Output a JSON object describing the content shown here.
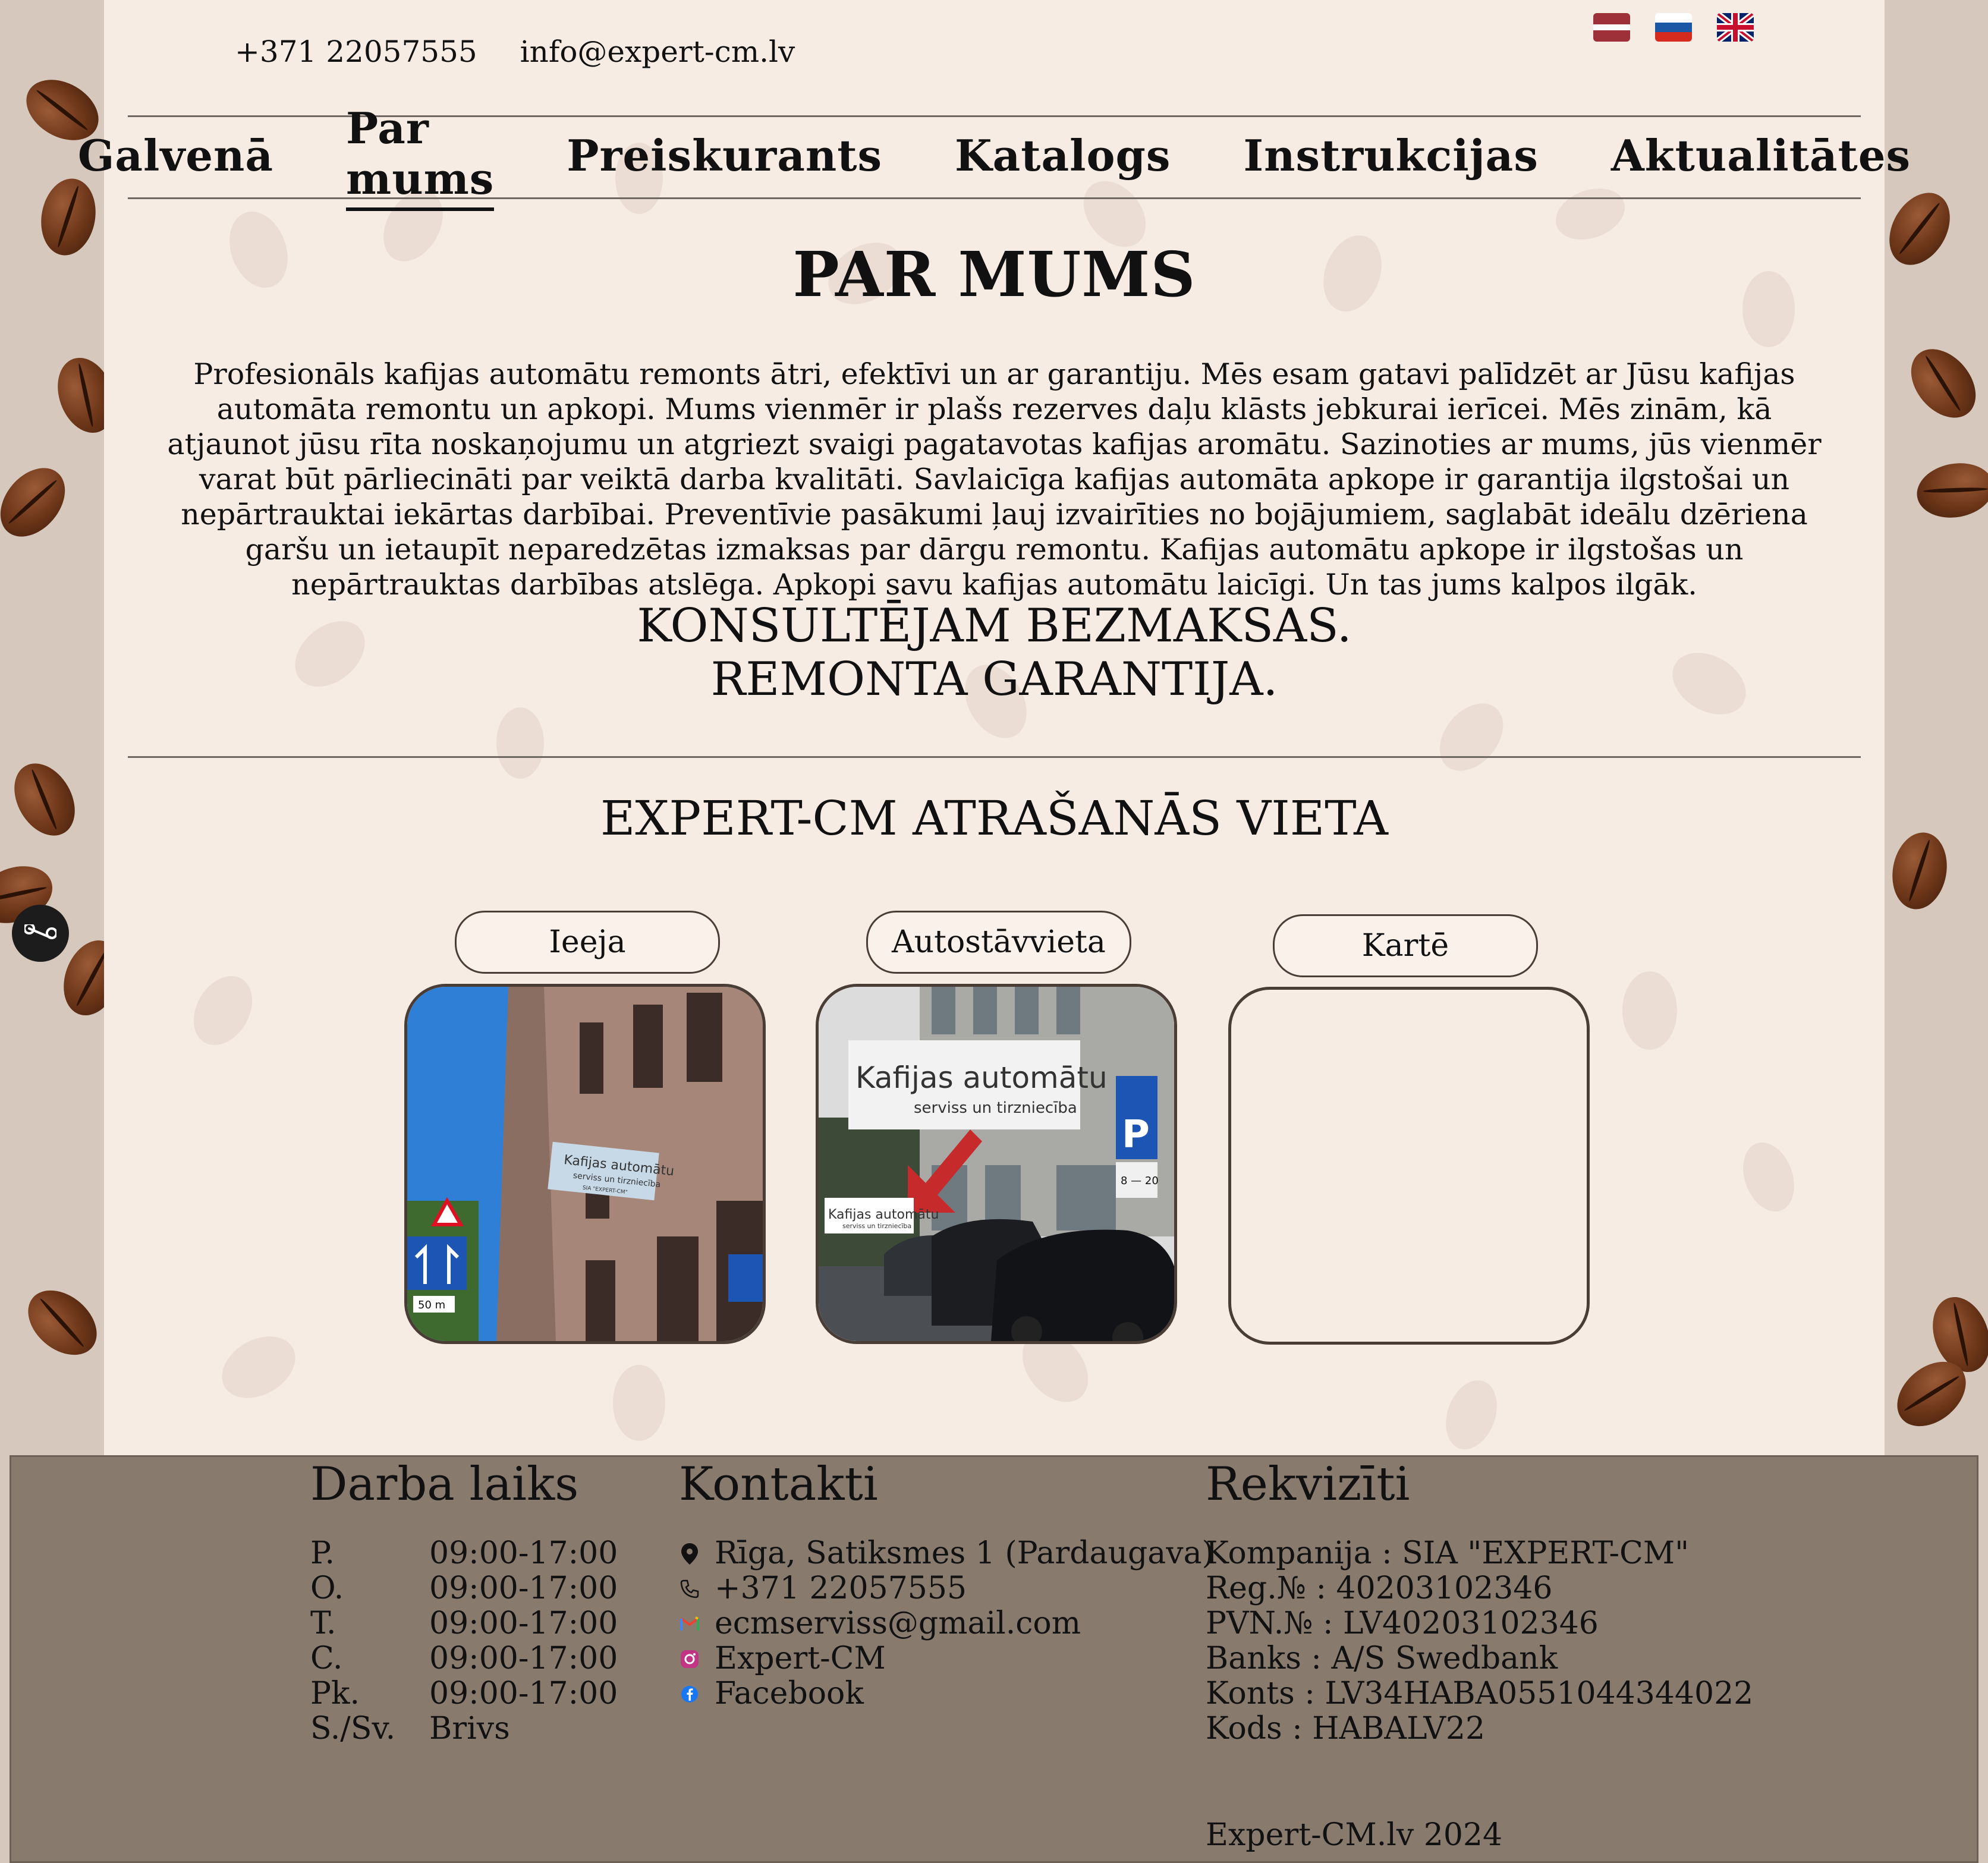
{
  "header": {
    "phone": "+371 22057555",
    "email": "info@expert-cm.lv",
    "flags": [
      "latvia-flag",
      "russia-flag",
      "uk-flag"
    ]
  },
  "nav": {
    "items": [
      {
        "label": "Galvenā"
      },
      {
        "label": "Par mums"
      },
      {
        "label": "Preiskurants"
      },
      {
        "label": "Katalogs"
      },
      {
        "label": "Instrukcijas"
      },
      {
        "label": "Aktualitātes"
      }
    ],
    "active": "Par mums"
  },
  "main": {
    "title": "PAR MUMS",
    "intro": "Profesionāls kafijas automātu remonts ātri, efektīvi un ar garantiju. Mēs esam gatavi palīdzēt ar Jūsu kafijas automāta remontu un apkopi. Mums vienmēr ir plašs rezerves daļu klāsts jebkurai ierīcei. Mēs zinām, kā atjaunot jūsu rīta noskaņojumu un atgriezt svaigi pagatavotas kafijas aromātu. Sazinoties ar mums, jūs vienmēr varat būt pārliecināti par veiktā darba kvalitāti. Savlaicīga kafijas automāta apkope ir garantija ilgstošai un nepārtrauktai iekārtas darbībai. Preventīvie pasākumi ļauj izvairīties no bojājumiem, saglabāt ideālu dzēriena garšu un ietaupīt neparedzētas izmaksas par dārgu remontu. Kafijas automātu apkope ir ilgstošas un nepārtrauktas darbības atslēga. Apkopi savu kafijas automātu laicīgi. Un tas jums kalpos ilgāk.",
    "slogan_line1": "KONSULTĒJAM BEZMAKSAS.",
    "slogan_line2": "REMONTA GARANTIJA.",
    "location_title": "EXPERT-CM ATRAŠANĀS VIETA",
    "cards": [
      {
        "label": "Ieeja"
      },
      {
        "label": "Autostāvvieta"
      },
      {
        "label": "Kartē"
      }
    ],
    "photo_signs": {
      "entrance_sign_line1": "Kafijas automātu",
      "entrance_sign_line2": "serviss un tirzniecība",
      "entrance_sign_line3": "SIA \"EXPERT-CM\"",
      "road_sign_distance": "50 m",
      "parking_banner_line1": "Kafijas automātu",
      "parking_banner_line2": "serviss un tirzniecība",
      "parking_small_sign_line1": "Kafijas automātu",
      "parking_small_sign_line2": "serviss un tirzniecība",
      "parking_letter": "P",
      "parking_hours": "8 — 20"
    }
  },
  "footer": {
    "hours_title": "Darba laiks",
    "hours": [
      {
        "day": "P.",
        "time": "09:00-17:00"
      },
      {
        "day": "O.",
        "time": "09:00-17:00"
      },
      {
        "day": "T.",
        "time": "09:00-17:00"
      },
      {
        "day": "C.",
        "time": "09:00-17:00"
      },
      {
        "day": "Pk.",
        "time": "09:00-17:00"
      },
      {
        "day": "S./Sv.",
        "time": "Brivs"
      }
    ],
    "contacts_title": "Kontakti",
    "contacts": [
      {
        "icon": "location-pin-icon",
        "text": "Rīga, Satiksmes 1 (Pardaugava)"
      },
      {
        "icon": "phone-icon",
        "text": "+371 22057555"
      },
      {
        "icon": "gmail-icon",
        "text": "ecmserviss@gmail.com"
      },
      {
        "icon": "instagram-icon",
        "text": "Expert-CM"
      },
      {
        "icon": "facebook-icon",
        "text": "Facebook"
      }
    ],
    "requisites_title": "Rekvizīti",
    "requisites": [
      "Kompanija : SIA \"EXPERT-CM\"",
      "Reg.№ : 40203102346",
      "PVN.№ : LV40203102346",
      "Banks : A/S Swedbank",
      "Konts : LV34HABA0551044344022",
      "Kods : HABALV22"
    ],
    "copyright": "Expert-CM.lv 2024"
  },
  "colors": {
    "page_bg": "#f6ece3",
    "footer_bg": "#897a6e",
    "text": "#111111",
    "border": "#4a3d35"
  }
}
